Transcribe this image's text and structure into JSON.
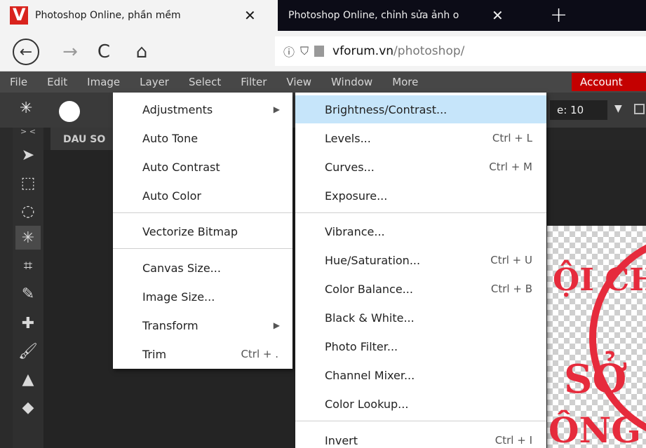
{
  "browser": {
    "tabs": [
      {
        "title": "Photoshop Online, phần mềm",
        "active": true
      },
      {
        "title": "Photoshop Online, chỉnh sửa ảnh o",
        "active": false
      }
    ],
    "close_glyph": "✕",
    "new_tab_glyph": "+",
    "nav": {
      "back": "←",
      "forward": "→",
      "reload": "C",
      "home": "⌂"
    },
    "url": {
      "info": "ⓘ",
      "shield": "⛉",
      "host": "vforum.vn",
      "path": "/photoshop/"
    }
  },
  "menubar": {
    "items": [
      "File",
      "Edit",
      "Image",
      "Layer",
      "Select",
      "Filter",
      "View",
      "Window",
      "More"
    ],
    "account": "Account"
  },
  "options": {
    "tolerance_label": "e:",
    "tolerance_value": "10",
    "dropdown": "▼"
  },
  "toolbox": {
    "collapse": "> <",
    "tools": [
      {
        "name": "move-icon",
        "glyph": "➤"
      },
      {
        "name": "marquee-icon",
        "glyph": "⬚"
      },
      {
        "name": "lasso-icon",
        "glyph": "◌"
      },
      {
        "name": "magic-wand-icon",
        "glyph": "✳"
      },
      {
        "name": "crop-icon",
        "glyph": "⌗"
      },
      {
        "name": "eyedropper-icon",
        "glyph": "✎"
      },
      {
        "name": "healing-icon",
        "glyph": "✚"
      },
      {
        "name": "brush-icon",
        "glyph": "🖌"
      },
      {
        "name": "stamp-icon",
        "glyph": "▲"
      },
      {
        "name": "eraser-icon",
        "glyph": "◆"
      }
    ]
  },
  "document": {
    "tab_name": "DAU SO",
    "stamp_lines": [
      "ỘI CH",
      "SỞ",
      "ÔNG"
    ]
  },
  "image_menu": {
    "items": [
      {
        "label": "Adjustments",
        "submenu": true
      },
      {
        "label": "Auto Tone"
      },
      {
        "label": "Auto Contrast"
      },
      {
        "label": "Auto Color"
      },
      {
        "label": "Vectorize Bitmap"
      },
      {
        "label": "Canvas Size..."
      },
      {
        "label": "Image Size..."
      },
      {
        "label": "Transform",
        "submenu": true
      },
      {
        "label": "Trim",
        "shortcut": "Ctrl + ."
      }
    ],
    "arrow": "▶"
  },
  "adjustments_menu": {
    "items": [
      {
        "label": "Brightness/Contrast...",
        "highlighted": true
      },
      {
        "label": "Levels...",
        "shortcut": "Ctrl + L"
      },
      {
        "label": "Curves...",
        "shortcut": "Ctrl + M"
      },
      {
        "label": "Exposure..."
      },
      {
        "label": "Vibrance..."
      },
      {
        "label": "Hue/Saturation...",
        "shortcut": "Ctrl + U"
      },
      {
        "label": "Color Balance...",
        "shortcut": "Ctrl + B"
      },
      {
        "label": "Black & White..."
      },
      {
        "label": "Photo Filter..."
      },
      {
        "label": "Channel Mixer..."
      },
      {
        "label": "Color Lookup..."
      },
      {
        "label": "Invert",
        "shortcut": "Ctrl + I"
      }
    ]
  },
  "colors": {
    "accent_highlight": "#c6e5fa",
    "account_red": "#c40000",
    "stamp_red": "#e62b3c"
  }
}
